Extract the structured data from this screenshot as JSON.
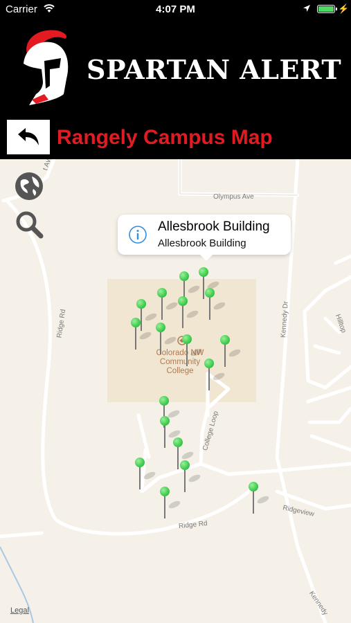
{
  "status_bar": {
    "carrier": "Carrier",
    "time": "4:07 PM"
  },
  "header": {
    "brand": "SPARTAN ALERT"
  },
  "titlebar": {
    "title": "Rangely Campus Map"
  },
  "map": {
    "roads": {
      "olympus": "Olympus Ave",
      "ridge_rd_v": "Ridge Rd",
      "ridge_rd_h": "Ridge Rd",
      "kennedy_dr": "Kennedy Dr",
      "kennedy_low": "Kennedy",
      "college_loop": "College Loop",
      "ridgeview": "Ridgeview",
      "hilltop": "Hilltop",
      "top_left": "t Ave"
    },
    "campus_label": "Colorado NW Community College",
    "callout": {
      "title": "Allesbrook Building",
      "subtitle": "Allesbrook Building"
    },
    "legal": "Legal",
    "pin_color": "#3ecb4e"
  }
}
